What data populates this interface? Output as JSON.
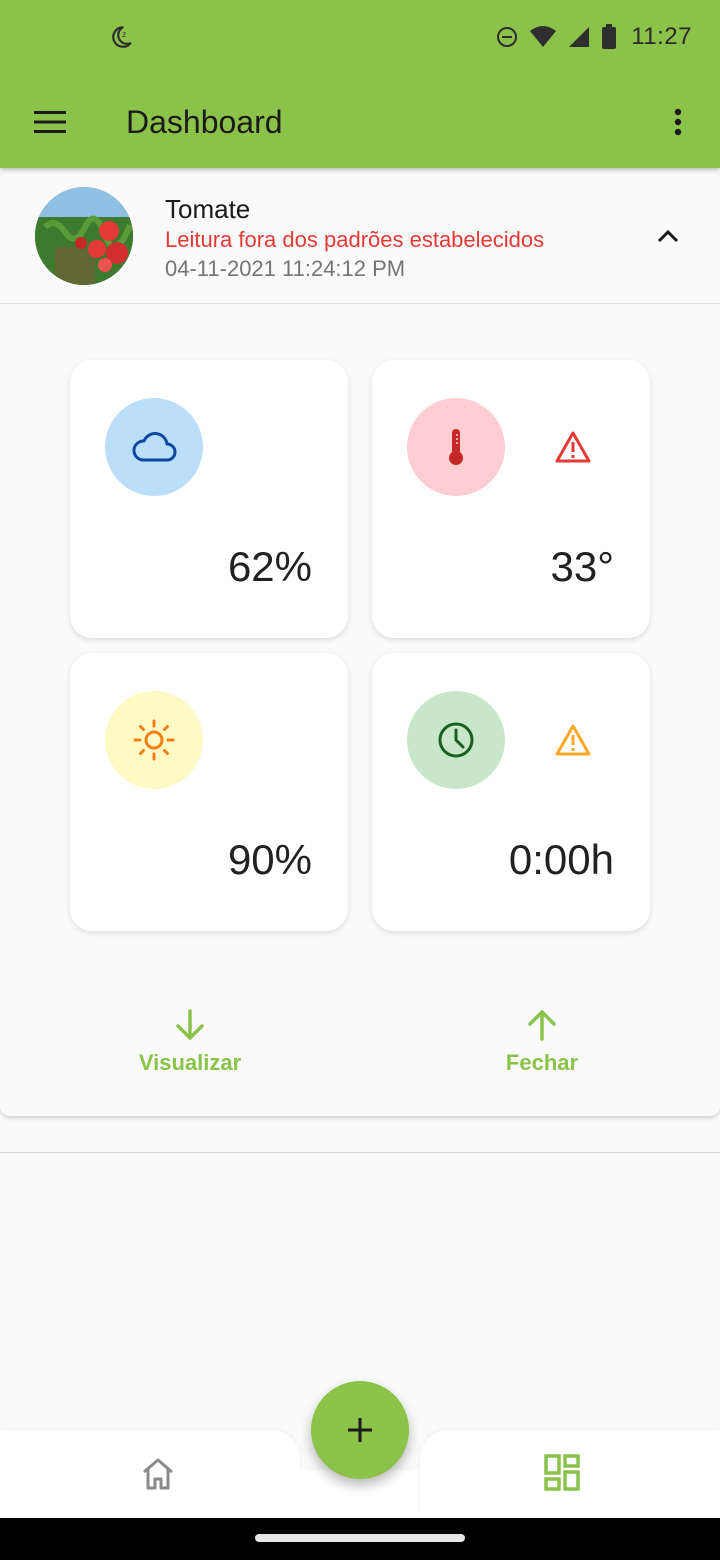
{
  "status_bar": {
    "time": "11:27"
  },
  "app_bar": {
    "title": "Dashboard"
  },
  "crop": {
    "name": "Tomate",
    "status": "Leitura fora dos padrões estabelecidos",
    "timestamp": "04-11-2021 11:24:12 PM"
  },
  "metrics": [
    {
      "icon": "cloud-icon",
      "value": "62%",
      "warning": false,
      "color": "#bbdefb",
      "icon_color": "#0d47a1"
    },
    {
      "icon": "thermometer-icon",
      "value": "33°",
      "warning": true,
      "warning_color": "#e53935",
      "color": "#ffcdd2",
      "icon_color": "#c62828"
    },
    {
      "icon": "sun-icon",
      "value": "90%",
      "warning": false,
      "color": "#fff9c4",
      "icon_color": "#f57f17"
    },
    {
      "icon": "clock-icon",
      "value": "0:00h",
      "warning": true,
      "warning_color": "#f9a825",
      "color": "#c8e6c9",
      "icon_color": "#1b5e20"
    }
  ],
  "actions": {
    "view": "Visualizar",
    "close": "Fechar"
  },
  "colors": {
    "primary": "#8bc34a",
    "alert": "#e53935",
    "secondary_text": "#757575"
  }
}
